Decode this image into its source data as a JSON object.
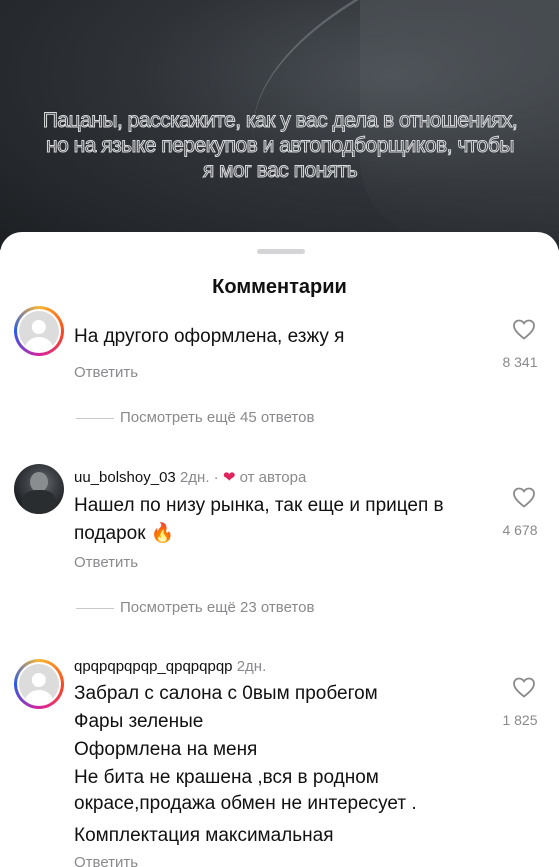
{
  "video": {
    "caption": "Пацаны, расскажите, как у вас дела в отношениях, но на языке перекупов и автоподборщиков, чтобы я мог вас понять"
  },
  "sheet": {
    "title": "Комментарии"
  },
  "comments": [
    {
      "username": "",
      "time": "",
      "text": "На другого оформлена, езжу я",
      "reply_label": "Ответить",
      "likes": "8 341",
      "view_more": "Посмотреть ещё 45 ответов"
    },
    {
      "username": "uu_bolshoy_03",
      "time": "2дн.",
      "separator": "·",
      "author_badge": "от автора",
      "text": "Нашел по низу рынка, так еще и прицеп в подарок 🔥",
      "reply_label": "Ответить",
      "likes": "4 678",
      "view_more": "Посмотреть ещё 23 ответов"
    },
    {
      "username": "qpqpqpqpqp_qpqpqpqp",
      "time": "2дн.",
      "lines": [
        "Забрал с салона с 0вым пробегом",
        "Фары зеленые",
        "Оформлена на меня",
        "Не бита не крашена ,вся в родном",
        "окрасе,продажа обмен не интересует .",
        "Комплектация максимальная"
      ],
      "reply_label": "Ответить",
      "likes": "1 825"
    }
  ],
  "icons": {
    "like": "heart-outline-icon",
    "author_heart": "heart-filled-icon"
  },
  "colors": {
    "muted": "#8a8a8e",
    "author_heart": "#e0245e"
  }
}
